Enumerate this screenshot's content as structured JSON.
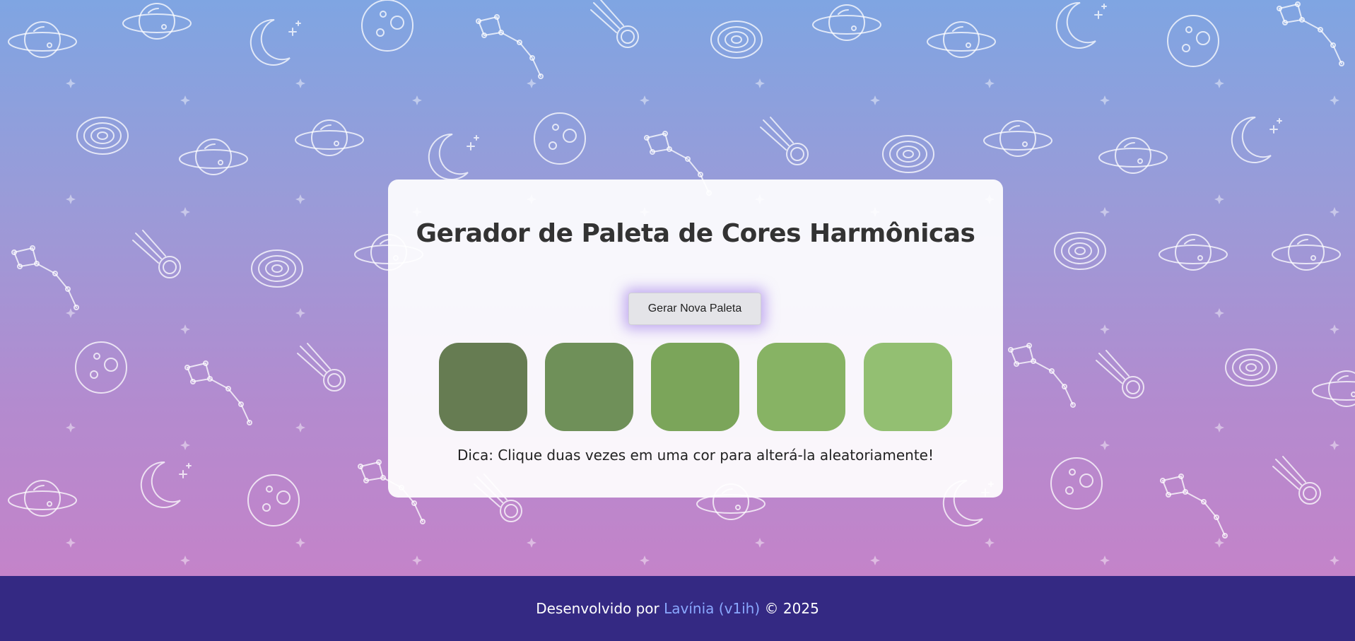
{
  "app": {
    "title": "Gerador de Paleta de Cores Harmônicas",
    "generate_button_label": "Gerar Nova Paleta",
    "tip": "Dica: Clique duas vezes em uma cor para alterá-la aleatoriamente!"
  },
  "palette": [
    {
      "color": "#667c52"
    },
    {
      "color": "#6f9059"
    },
    {
      "color": "#7ba55a"
    },
    {
      "color": "#87b364"
    },
    {
      "color": "#93bf72"
    }
  ],
  "footer": {
    "prefix": "Desenvolvido por",
    "author_link": "Lavínia (v1ih)",
    "suffix": "© 2025"
  },
  "theme": {
    "gradient_top": "#7fa5e2",
    "gradient_bottom": "#c483c9",
    "footer_bg": "#342983",
    "link_color": "#8aa8ff"
  },
  "background_icons": [
    "planet-icon",
    "moon-icon",
    "comet-icon",
    "galaxy-icon",
    "constellation-icon",
    "moon-crater-icon",
    "star-icon"
  ]
}
